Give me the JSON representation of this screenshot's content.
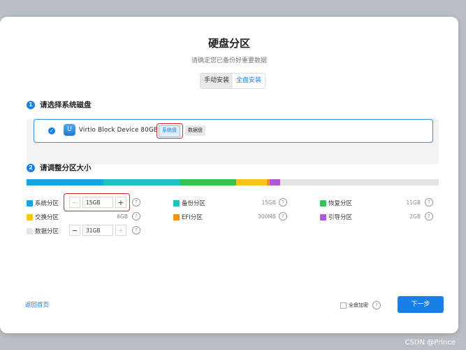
{
  "dialog": {
    "title": "硬盘分区",
    "subtitle": "请确定您已备份好重要数据",
    "tabs": [
      {
        "label": "手动安装",
        "active": false
      },
      {
        "label": "全盘安装",
        "active": true
      }
    ]
  },
  "step1": {
    "number": "1",
    "title": "请选择系统磁盘",
    "disk": {
      "selected": true,
      "name": "Virtio Block Device 80GB",
      "icon": "disk-icon",
      "tags": [
        {
          "label": "系统盘",
          "active": true
        },
        {
          "label": "数据盘",
          "active": false
        }
      ]
    }
  },
  "step2": {
    "number": "2",
    "title": "请调整分区大小",
    "bar_segments": [
      {
        "name": "系统分区",
        "color": "#17a4e0",
        "size_gb": 15
      },
      {
        "name": "备份分区",
        "color": "#1fc2c0",
        "size_gb": 15
      },
      {
        "name": "恢复分区",
        "color": "#33c34f",
        "size_gb": 11
      },
      {
        "name": "交换分区",
        "color": "#f5c518",
        "size_gb": 6
      },
      {
        "name": "EFI分区",
        "color": "#f5901b",
        "size_gb": 0.3
      },
      {
        "name": "引导分区",
        "color": "#b05bd6",
        "size_gb": 2
      },
      {
        "name": "数据分区",
        "color": "#e4e4e4",
        "size_gb": 31
      }
    ],
    "partitions": {
      "system": {
        "label": "系统分区",
        "color": "#17a4e0",
        "value": "15GB",
        "minus": "−",
        "plus": "+"
      },
      "backup": {
        "label": "备份分区",
        "color": "#1fc2c0",
        "size": "15GB"
      },
      "recovery": {
        "label": "恢复分区",
        "color": "#33c34f",
        "size": "11GB"
      },
      "swap": {
        "label": "交换分区",
        "color": "#f5c518",
        "size": "6GB"
      },
      "efi": {
        "label": "EFI分区",
        "color": "#f5901b",
        "size": "300MB"
      },
      "boot": {
        "label": "引导分区",
        "color": "#b05bd6",
        "size": "2GB"
      },
      "data": {
        "label": "数据分区",
        "color": "#e4e4e4",
        "value": "31GB",
        "minus": "−",
        "plus": "+"
      }
    },
    "help_glyph": "?"
  },
  "footer": {
    "back_label": "返回首页",
    "encrypt_label": "全盘加密",
    "encrypt_checked": false,
    "next_label": "下一步"
  },
  "watermark": "CSDN @Prince"
}
